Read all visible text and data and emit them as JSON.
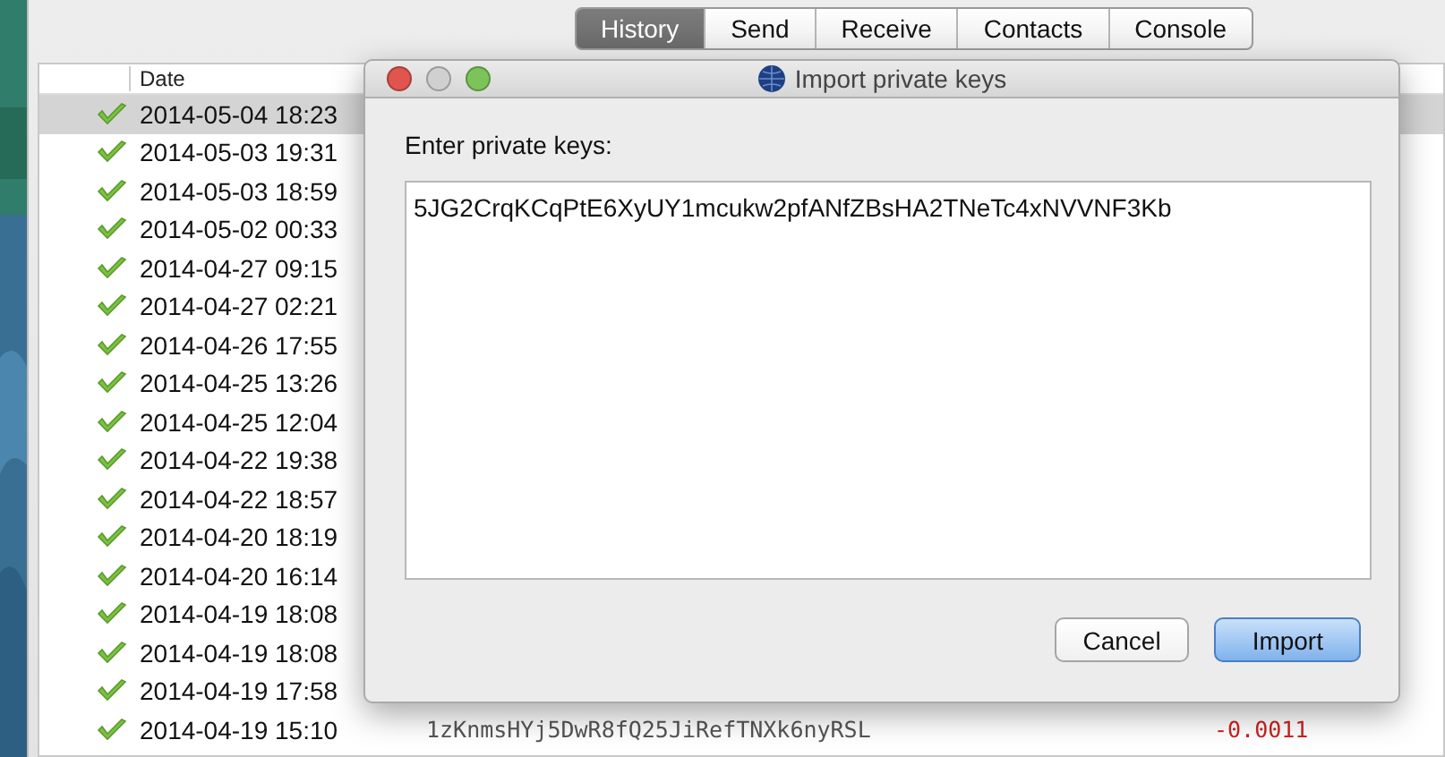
{
  "tabs": [
    {
      "label": "History",
      "selected": true
    },
    {
      "label": "Send",
      "selected": false
    },
    {
      "label": "Receive",
      "selected": false
    },
    {
      "label": "Contacts",
      "selected": false
    },
    {
      "label": "Console",
      "selected": false
    }
  ],
  "table": {
    "columns": [
      "Date"
    ],
    "rows": [
      {
        "date": "2014-05-04 18:23",
        "selected": true
      },
      {
        "date": "2014-05-03 19:31",
        "selected": false
      },
      {
        "date": "2014-05-03 18:59",
        "selected": false
      },
      {
        "date": "2014-05-02 00:33",
        "selected": false
      },
      {
        "date": "2014-04-27 09:15",
        "selected": false
      },
      {
        "date": "2014-04-27 02:21",
        "selected": false
      },
      {
        "date": "2014-04-26 17:55",
        "selected": false
      },
      {
        "date": "2014-04-25 13:26",
        "selected": false
      },
      {
        "date": "2014-04-25 12:04",
        "selected": false
      },
      {
        "date": "2014-04-22 19:38",
        "selected": false
      },
      {
        "date": "2014-04-22 18:57",
        "selected": false
      },
      {
        "date": "2014-04-20 18:19",
        "selected": false
      },
      {
        "date": "2014-04-20 16:14",
        "selected": false
      },
      {
        "date": "2014-04-19 18:08",
        "selected": false
      },
      {
        "date": "2014-04-19 18:08",
        "selected": false
      },
      {
        "date": "2014-04-19 17:58",
        "selected": false
      },
      {
        "date": "2014-04-19 15:10",
        "selected": false,
        "address": "1zKnmsHYj5DwR8fQ25JiRefTNXk6nyRSL",
        "amount": "-0.0011"
      }
    ]
  },
  "dialog": {
    "title": "Import private keys",
    "label": "Enter private keys:",
    "value": "5JG2CrqKCqPtE6XyUY1mcukw2pfANfZBsHA2TNeTc4xNVVNF3Kb",
    "buttons": [
      {
        "label": "Cancel",
        "kind": "secondary"
      },
      {
        "label": "Import",
        "kind": "default"
      }
    ]
  }
}
